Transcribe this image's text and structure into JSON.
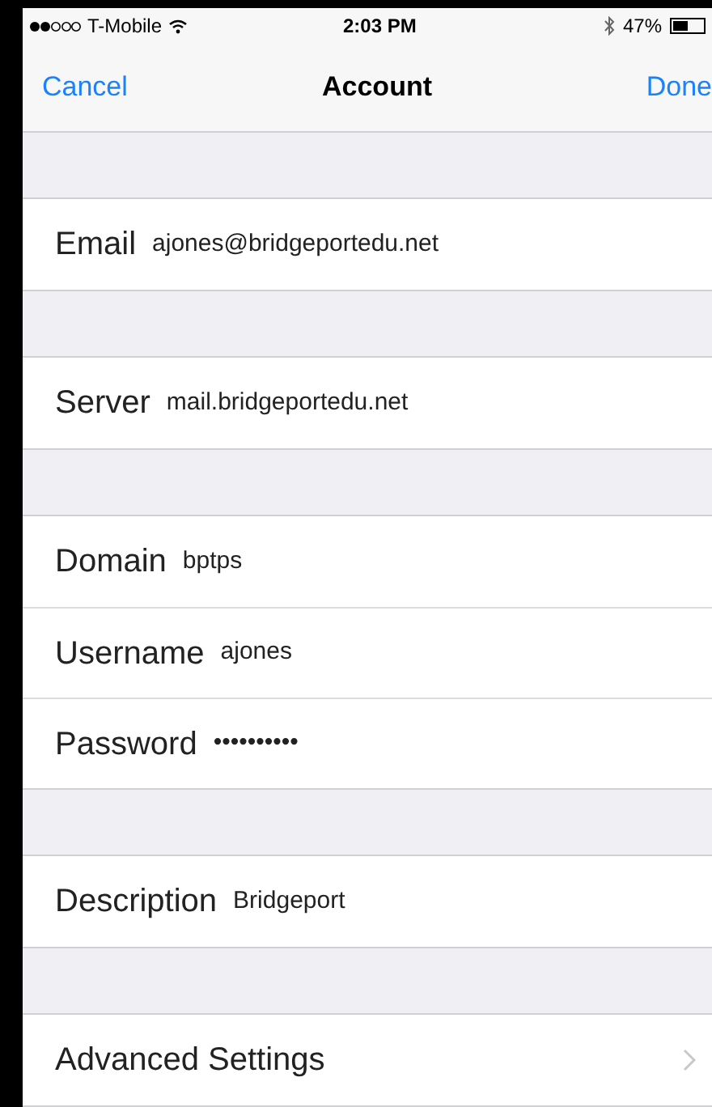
{
  "status_bar": {
    "carrier": "T-Mobile",
    "time": "2:03 PM",
    "battery": "47%"
  },
  "nav": {
    "cancel": "Cancel",
    "title": "Account",
    "done": "Done"
  },
  "groups": [
    {
      "rows": [
        {
          "kind": "field",
          "label": "Email",
          "value": "ajones@bridgeportedu.net"
        }
      ]
    },
    {
      "rows": [
        {
          "kind": "field",
          "label": "Server",
          "value": "mail.bridgeportedu.net"
        }
      ]
    },
    {
      "rows": [
        {
          "kind": "field",
          "label": "Domain",
          "value": "bptps"
        },
        {
          "kind": "field",
          "label": "Username",
          "value": "ajones"
        },
        {
          "kind": "field",
          "label": "Password",
          "value": "••••••••••"
        }
      ]
    },
    {
      "rows": [
        {
          "kind": "field",
          "label": "Description",
          "value": "Bridgeport"
        }
      ]
    },
    {
      "rows": [
        {
          "kind": "link",
          "label": "Advanced Settings"
        }
      ]
    }
  ]
}
